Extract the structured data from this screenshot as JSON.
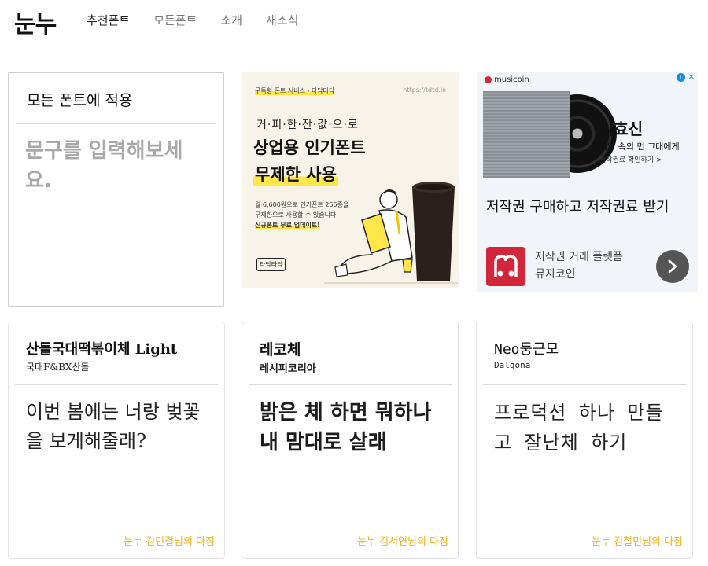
{
  "header": {
    "logo": "눈누",
    "nav": [
      {
        "label": "추천폰트",
        "active": true
      },
      {
        "label": "모든폰트",
        "active": false
      },
      {
        "label": "소개",
        "active": false
      },
      {
        "label": "새소식",
        "active": false
      }
    ]
  },
  "input_card": {
    "title": "모든 폰트에 적용",
    "placeholder": "문구를 입력해보세요."
  },
  "ad1": {
    "tag": "구독형 폰트 서비스 - 타닥타닥",
    "url": "https://tdtd.io",
    "tagline": "커·피·한·잔·값·으·로",
    "headline1": "상업용 인기폰트",
    "headline2": "무제한 사용",
    "desc_line1": "월 6,600원으로 인기폰트 255종을",
    "desc_line2": "무제한으로 사용할 수 있습니다",
    "desc_line3": "신규폰트 무료 업데이트!",
    "brand": "타닥타닥"
  },
  "ad2": {
    "logo": "musicoin",
    "artist": "박효신",
    "song": "기억 속의 먼 그대에게",
    "more": "저작권료 확인하기 >",
    "title": "저작권 구매하고 저작권료 받기",
    "app_name_line1": "저작권 거래 플랫폼",
    "app_name_line2": "뮤지코인",
    "adchoice_icon": "info-icon",
    "close_icon": "close-icon",
    "next_icon": "chevron-right-icon",
    "brand_color": "#d3263a"
  },
  "font_cards": [
    {
      "name": "산돌국대떡볶이체 Light",
      "author": "국대F&BX산돌",
      "sample": "이번 봄에는 너랑 벚꽃을 보게해줄래?",
      "credit": "눈누 김민결님의 다짐"
    },
    {
      "name": "레코체",
      "author": "레시피코리아",
      "sample": "밝은 체 하면 뭐하나 내 맘대로 살래",
      "credit": "눈누 김서연님의 다짐"
    },
    {
      "name": "Neo둥근모",
      "author": "Dalgona",
      "sample": "프로덕션 하나 만들고 잘난체 하기",
      "credit": "눈누 김철민님의 다짐"
    }
  ],
  "colors": {
    "credit": "#f2b21a",
    "highlight": "#ffe74a"
  }
}
